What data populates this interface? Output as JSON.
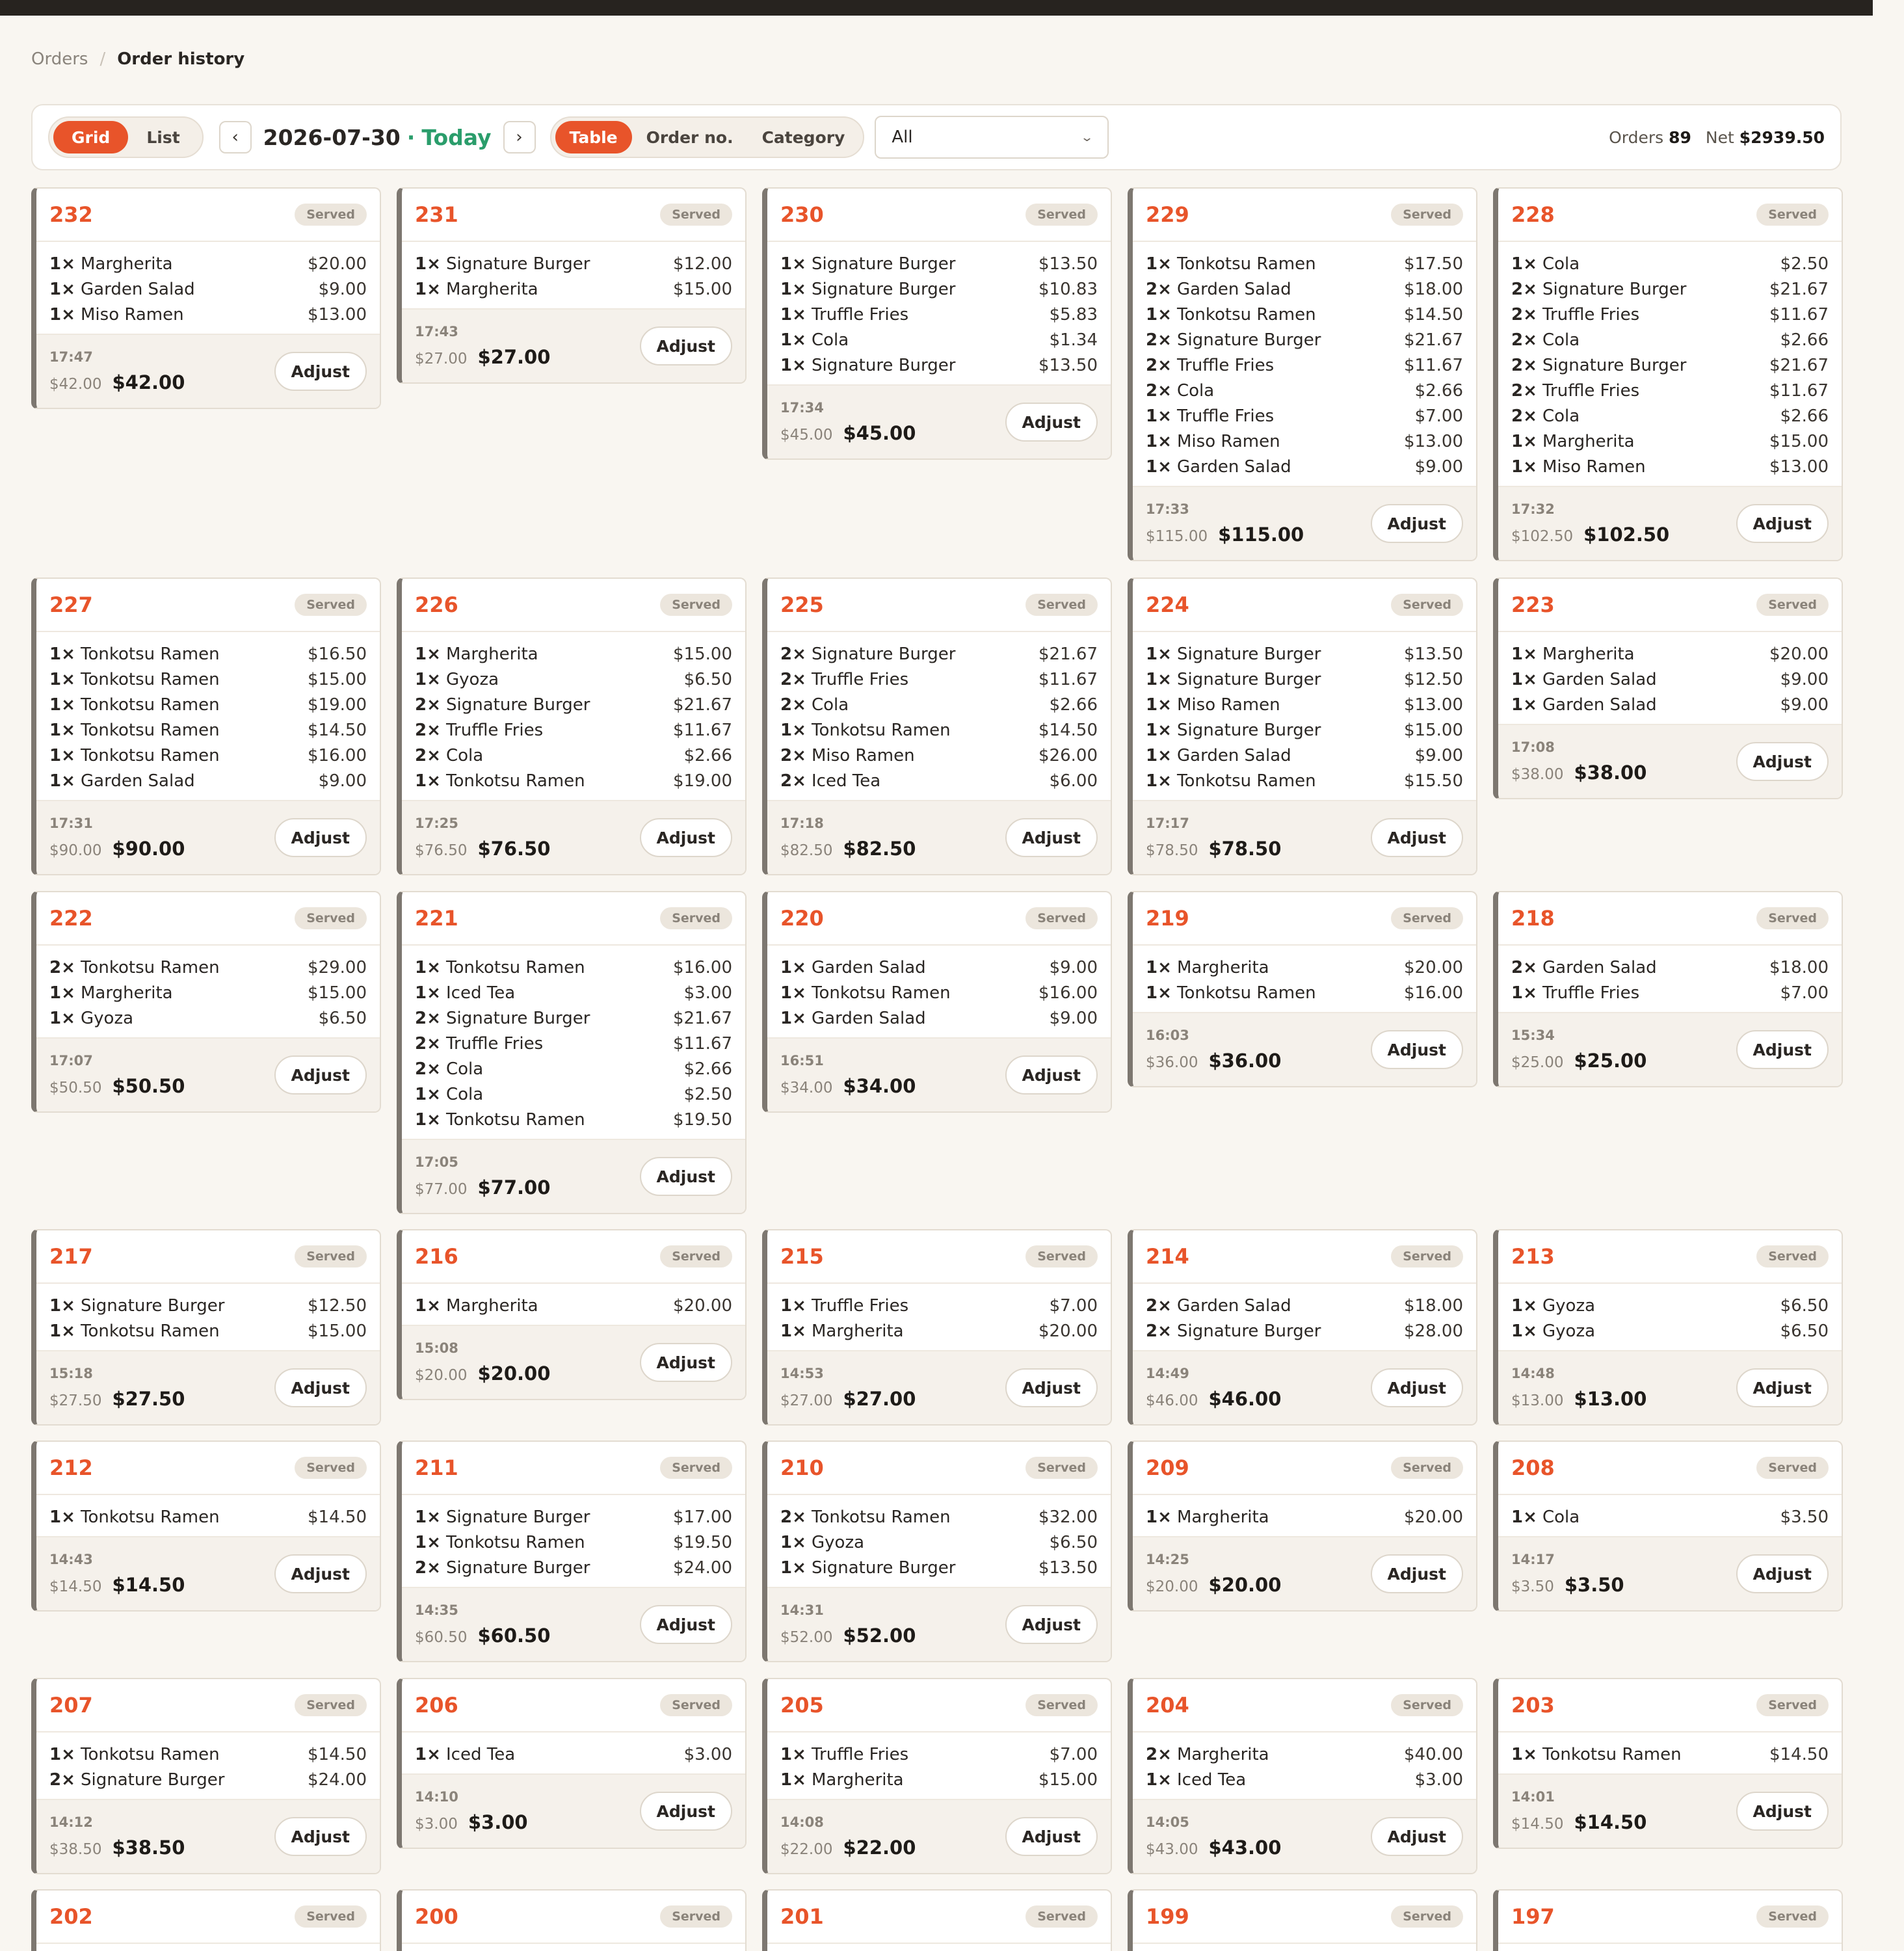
{
  "breadcrumb": {
    "root": "Orders",
    "separator": "/",
    "current": "Order history"
  },
  "toolbar": {
    "view_modes": [
      "Grid",
      "List"
    ],
    "active_view": "Grid",
    "prev_label": "‹",
    "next_label": "›",
    "date": "2026-07-30",
    "date_sep": "·",
    "today": "Today",
    "group_modes": [
      "Table",
      "Order no.",
      "Category"
    ],
    "active_group": "Table",
    "filter_value": "All",
    "orders_label": "Orders",
    "orders_count": "89",
    "net_label": "Net",
    "net_value": "$2939.50"
  },
  "colors": {
    "accent": "#e8542a",
    "today": "#2a9d6b",
    "card_border": "#7d7770"
  },
  "adjust_label": "Adjust",
  "orders": [
    {
      "no": "232",
      "status": "Served",
      "time": "17:47",
      "subtotal": "$42.00",
      "total": "$42.00",
      "items": [
        [
          "1×",
          "Margherita",
          "$20.00"
        ],
        [
          "1×",
          "Garden Salad",
          "$9.00"
        ],
        [
          "1×",
          "Miso Ramen",
          "$13.00"
        ]
      ]
    },
    {
      "no": "231",
      "status": "Served",
      "time": "17:43",
      "subtotal": "$27.00",
      "total": "$27.00",
      "items": [
        [
          "1×",
          "Signature Burger",
          "$12.00"
        ],
        [
          "1×",
          "Margherita",
          "$15.00"
        ]
      ]
    },
    {
      "no": "230",
      "status": "Served",
      "time": "17:34",
      "subtotal": "$45.00",
      "total": "$45.00",
      "items": [
        [
          "1×",
          "Signature Burger",
          "$13.50"
        ],
        [
          "1×",
          "Signature Burger",
          "$10.83"
        ],
        [
          "1×",
          "Truffle Fries",
          "$5.83"
        ],
        [
          "1×",
          "Cola",
          "$1.34"
        ],
        [
          "1×",
          "Signature Burger",
          "$13.50"
        ]
      ]
    },
    {
      "no": "229",
      "status": "Served",
      "time": "17:33",
      "subtotal": "$115.00",
      "total": "$115.00",
      "items": [
        [
          "1×",
          "Tonkotsu Ramen",
          "$17.50"
        ],
        [
          "2×",
          "Garden Salad",
          "$18.00"
        ],
        [
          "1×",
          "Tonkotsu Ramen",
          "$14.50"
        ],
        [
          "2×",
          "Signature Burger",
          "$21.67"
        ],
        [
          "2×",
          "Truffle Fries",
          "$11.67"
        ],
        [
          "2×",
          "Cola",
          "$2.66"
        ],
        [
          "1×",
          "Truffle Fries",
          "$7.00"
        ],
        [
          "1×",
          "Miso Ramen",
          "$13.00"
        ],
        [
          "1×",
          "Garden Salad",
          "$9.00"
        ]
      ]
    },
    {
      "no": "228",
      "status": "Served",
      "time": "17:32",
      "subtotal": "$102.50",
      "total": "$102.50",
      "items": [
        [
          "1×",
          "Cola",
          "$2.50"
        ],
        [
          "2×",
          "Signature Burger",
          "$21.67"
        ],
        [
          "2×",
          "Truffle Fries",
          "$11.67"
        ],
        [
          "2×",
          "Cola",
          "$2.66"
        ],
        [
          "2×",
          "Signature Burger",
          "$21.67"
        ],
        [
          "2×",
          "Truffle Fries",
          "$11.67"
        ],
        [
          "2×",
          "Cola",
          "$2.66"
        ],
        [
          "1×",
          "Margherita",
          "$15.00"
        ],
        [
          "1×",
          "Miso Ramen",
          "$13.00"
        ]
      ]
    },
    {
      "no": "227",
      "status": "Served",
      "time": "17:31",
      "subtotal": "$90.00",
      "total": "$90.00",
      "items": [
        [
          "1×",
          "Tonkotsu Ramen",
          "$16.50"
        ],
        [
          "1×",
          "Tonkotsu Ramen",
          "$15.00"
        ],
        [
          "1×",
          "Tonkotsu Ramen",
          "$19.00"
        ],
        [
          "1×",
          "Tonkotsu Ramen",
          "$14.50"
        ],
        [
          "1×",
          "Tonkotsu Ramen",
          "$16.00"
        ],
        [
          "1×",
          "Garden Salad",
          "$9.00"
        ]
      ]
    },
    {
      "no": "226",
      "status": "Served",
      "time": "17:25",
      "subtotal": "$76.50",
      "total": "$76.50",
      "items": [
        [
          "1×",
          "Margherita",
          "$15.00"
        ],
        [
          "1×",
          "Gyoza",
          "$6.50"
        ],
        [
          "2×",
          "Signature Burger",
          "$21.67"
        ],
        [
          "2×",
          "Truffle Fries",
          "$11.67"
        ],
        [
          "2×",
          "Cola",
          "$2.66"
        ],
        [
          "1×",
          "Tonkotsu Ramen",
          "$19.00"
        ]
      ]
    },
    {
      "no": "225",
      "status": "Served",
      "time": "17:18",
      "subtotal": "$82.50",
      "total": "$82.50",
      "items": [
        [
          "2×",
          "Signature Burger",
          "$21.67"
        ],
        [
          "2×",
          "Truffle Fries",
          "$11.67"
        ],
        [
          "2×",
          "Cola",
          "$2.66"
        ],
        [
          "1×",
          "Tonkotsu Ramen",
          "$14.50"
        ],
        [
          "2×",
          "Miso Ramen",
          "$26.00"
        ],
        [
          "2×",
          "Iced Tea",
          "$6.00"
        ]
      ]
    },
    {
      "no": "224",
      "status": "Served",
      "time": "17:17",
      "subtotal": "$78.50",
      "total": "$78.50",
      "items": [
        [
          "1×",
          "Signature Burger",
          "$13.50"
        ],
        [
          "1×",
          "Signature Burger",
          "$12.50"
        ],
        [
          "1×",
          "Miso Ramen",
          "$13.00"
        ],
        [
          "1×",
          "Signature Burger",
          "$15.00"
        ],
        [
          "1×",
          "Garden Salad",
          "$9.00"
        ],
        [
          "1×",
          "Tonkotsu Ramen",
          "$15.50"
        ]
      ]
    },
    {
      "no": "223",
      "status": "Served",
      "time": "17:08",
      "subtotal": "$38.00",
      "total": "$38.00",
      "items": [
        [
          "1×",
          "Margherita",
          "$20.00"
        ],
        [
          "1×",
          "Garden Salad",
          "$9.00"
        ],
        [
          "1×",
          "Garden Salad",
          "$9.00"
        ]
      ]
    },
    {
      "no": "222",
      "status": "Served",
      "time": "17:07",
      "subtotal": "$50.50",
      "total": "$50.50",
      "items": [
        [
          "2×",
          "Tonkotsu Ramen",
          "$29.00"
        ],
        [
          "1×",
          "Margherita",
          "$15.00"
        ],
        [
          "1×",
          "Gyoza",
          "$6.50"
        ]
      ]
    },
    {
      "no": "221",
      "status": "Served",
      "time": "17:05",
      "subtotal": "$77.00",
      "total": "$77.00",
      "items": [
        [
          "1×",
          "Tonkotsu Ramen",
          "$16.00"
        ],
        [
          "1×",
          "Iced Tea",
          "$3.00"
        ],
        [
          "2×",
          "Signature Burger",
          "$21.67"
        ],
        [
          "2×",
          "Truffle Fries",
          "$11.67"
        ],
        [
          "2×",
          "Cola",
          "$2.66"
        ],
        [
          "1×",
          "Cola",
          "$2.50"
        ],
        [
          "1×",
          "Tonkotsu Ramen",
          "$19.50"
        ]
      ]
    },
    {
      "no": "220",
      "status": "Served",
      "time": "16:51",
      "subtotal": "$34.00",
      "total": "$34.00",
      "items": [
        [
          "1×",
          "Garden Salad",
          "$9.00"
        ],
        [
          "1×",
          "Tonkotsu Ramen",
          "$16.00"
        ],
        [
          "1×",
          "Garden Salad",
          "$9.00"
        ]
      ]
    },
    {
      "no": "219",
      "status": "Served",
      "time": "16:03",
      "subtotal": "$36.00",
      "total": "$36.00",
      "items": [
        [
          "1×",
          "Margherita",
          "$20.00"
        ],
        [
          "1×",
          "Tonkotsu Ramen",
          "$16.00"
        ]
      ]
    },
    {
      "no": "218",
      "status": "Served",
      "time": "15:34",
      "subtotal": "$25.00",
      "total": "$25.00",
      "items": [
        [
          "2×",
          "Garden Salad",
          "$18.00"
        ],
        [
          "1×",
          "Truffle Fries",
          "$7.00"
        ]
      ]
    },
    {
      "no": "217",
      "status": "Served",
      "time": "15:18",
      "subtotal": "$27.50",
      "total": "$27.50",
      "items": [
        [
          "1×",
          "Signature Burger",
          "$12.50"
        ],
        [
          "1×",
          "Tonkotsu Ramen",
          "$15.00"
        ]
      ]
    },
    {
      "no": "216",
      "status": "Served",
      "time": "15:08",
      "subtotal": "$20.00",
      "total": "$20.00",
      "items": [
        [
          "1×",
          "Margherita",
          "$20.00"
        ]
      ]
    },
    {
      "no": "215",
      "status": "Served",
      "time": "14:53",
      "subtotal": "$27.00",
      "total": "$27.00",
      "items": [
        [
          "1×",
          "Truffle Fries",
          "$7.00"
        ],
        [
          "1×",
          "Margherita",
          "$20.00"
        ]
      ]
    },
    {
      "no": "214",
      "status": "Served",
      "time": "14:49",
      "subtotal": "$46.00",
      "total": "$46.00",
      "items": [
        [
          "2×",
          "Garden Salad",
          "$18.00"
        ],
        [
          "2×",
          "Signature Burger",
          "$28.00"
        ]
      ]
    },
    {
      "no": "213",
      "status": "Served",
      "time": "14:48",
      "subtotal": "$13.00",
      "total": "$13.00",
      "items": [
        [
          "1×",
          "Gyoza",
          "$6.50"
        ],
        [
          "1×",
          "Gyoza",
          "$6.50"
        ]
      ]
    },
    {
      "no": "212",
      "status": "Served",
      "time": "14:43",
      "subtotal": "$14.50",
      "total": "$14.50",
      "items": [
        [
          "1×",
          "Tonkotsu Ramen",
          "$14.50"
        ]
      ]
    },
    {
      "no": "211",
      "status": "Served",
      "time": "14:35",
      "subtotal": "$60.50",
      "total": "$60.50",
      "items": [
        [
          "1×",
          "Signature Burger",
          "$17.00"
        ],
        [
          "1×",
          "Tonkotsu Ramen",
          "$19.50"
        ],
        [
          "2×",
          "Signature Burger",
          "$24.00"
        ]
      ]
    },
    {
      "no": "210",
      "status": "Served",
      "time": "14:31",
      "subtotal": "$52.00",
      "total": "$52.00",
      "items": [
        [
          "2×",
          "Tonkotsu Ramen",
          "$32.00"
        ],
        [
          "1×",
          "Gyoza",
          "$6.50"
        ],
        [
          "1×",
          "Signature Burger",
          "$13.50"
        ]
      ]
    },
    {
      "no": "209",
      "status": "Served",
      "time": "14:25",
      "subtotal": "$20.00",
      "total": "$20.00",
      "items": [
        [
          "1×",
          "Margherita",
          "$20.00"
        ]
      ]
    },
    {
      "no": "208",
      "status": "Served",
      "time": "14:17",
      "subtotal": "$3.50",
      "total": "$3.50",
      "items": [
        [
          "1×",
          "Cola",
          "$3.50"
        ]
      ]
    },
    {
      "no": "207",
      "status": "Served",
      "time": "14:12",
      "subtotal": "$38.50",
      "total": "$38.50",
      "items": [
        [
          "1×",
          "Tonkotsu Ramen",
          "$14.50"
        ],
        [
          "2×",
          "Signature Burger",
          "$24.00"
        ]
      ]
    },
    {
      "no": "206",
      "status": "Served",
      "time": "14:10",
      "subtotal": "$3.00",
      "total": "$3.00",
      "items": [
        [
          "1×",
          "Iced Tea",
          "$3.00"
        ]
      ]
    },
    {
      "no": "205",
      "status": "Served",
      "time": "14:08",
      "subtotal": "$22.00",
      "total": "$22.00",
      "items": [
        [
          "1×",
          "Truffle Fries",
          "$7.00"
        ],
        [
          "1×",
          "Margherita",
          "$15.00"
        ]
      ]
    },
    {
      "no": "204",
      "status": "Served",
      "time": "14:05",
      "subtotal": "$43.00",
      "total": "$43.00",
      "items": [
        [
          "2×",
          "Margherita",
          "$40.00"
        ],
        [
          "1×",
          "Iced Tea",
          "$3.00"
        ]
      ]
    },
    {
      "no": "203",
      "status": "Served",
      "time": "14:01",
      "subtotal": "$14.50",
      "total": "$14.50",
      "items": [
        [
          "1×",
          "Tonkotsu Ramen",
          "$14.50"
        ]
      ]
    },
    {
      "no": "202",
      "status": "Served",
      "items": []
    },
    {
      "no": "200",
      "status": "Served",
      "items": []
    },
    {
      "no": "201",
      "status": "Served",
      "items": []
    },
    {
      "no": "199",
      "status": "Served",
      "items": []
    },
    {
      "no": "197",
      "status": "Served",
      "items": []
    }
  ]
}
